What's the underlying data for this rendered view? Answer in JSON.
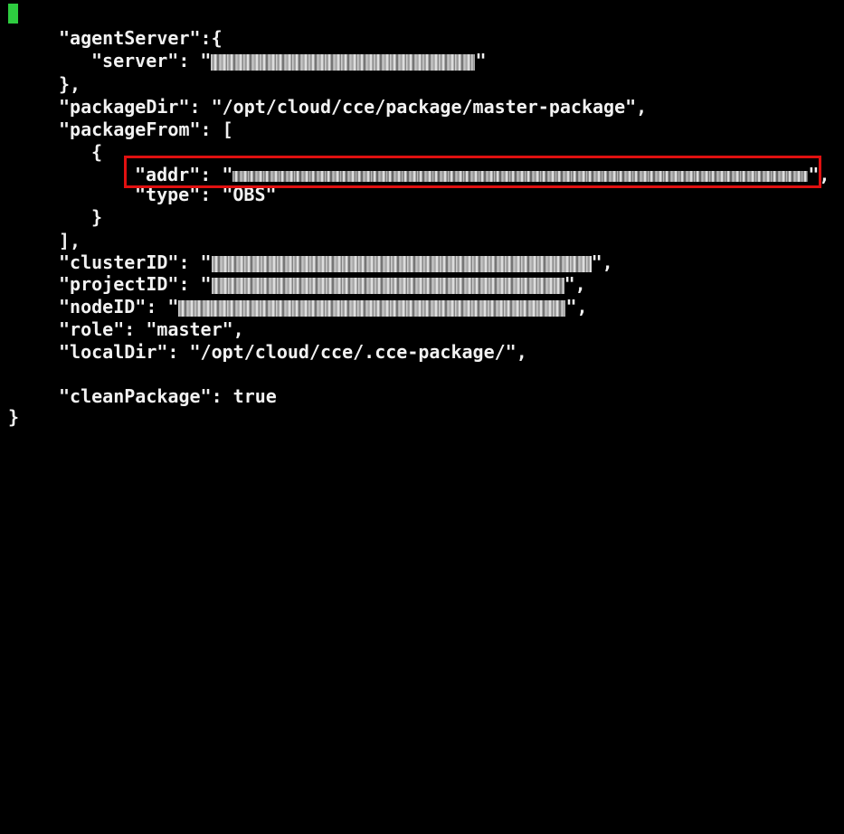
{
  "json_content": {
    "open_brace": "{",
    "agent_server_key": "\"agentServer\":{",
    "server_key": "\"server\": \"",
    "server_quote": "\"",
    "agent_server_close": "},",
    "package_dir": "\"packageDir\": \"/opt/cloud/cce/package/master-package\",",
    "package_from_key": "\"packageFrom\": [",
    "inner_open": "{",
    "addr_key": "\"addr\": \"",
    "addr_end": "\",",
    "type_line": "\"type\": \"OBS\"",
    "inner_close": "}",
    "array_close": "],",
    "cluster_id_key": "\"clusterID\": \"",
    "cluster_id_end": "\",",
    "project_id_key": "\"projectID\": \"",
    "project_id_end": "\",",
    "node_id_key": "\"nodeID\": \"",
    "node_id_end": "\",",
    "role_line": "\"role\": \"master\",",
    "local_dir_line": "\"localDir\": \"/opt/cloud/cce/.cce-package/\",",
    "clean_package_line": "\"cleanPackage\": true",
    "close_brace": "}"
  },
  "colors": {
    "background": "#000000",
    "text": "#f2f2f2",
    "cursor": "#2ecc40",
    "highlight_border": "#e01010"
  }
}
